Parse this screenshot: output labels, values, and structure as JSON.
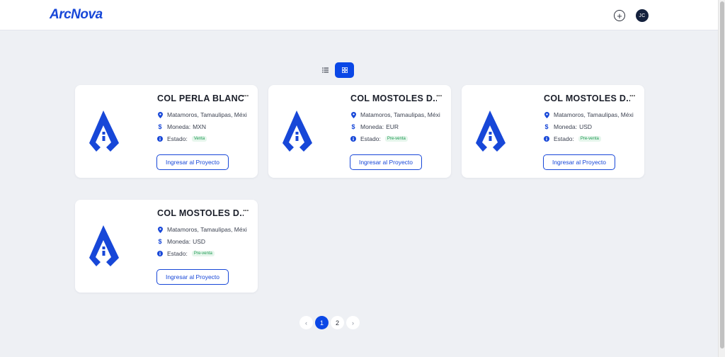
{
  "header": {
    "logo_text": "ArcNova",
    "add_icon": "plus-circle-icon",
    "avatar_initials": "JC"
  },
  "view_toggle": {
    "list_icon": "list-icon",
    "grid_icon": "grid-icon",
    "active": "grid"
  },
  "colors": {
    "brand": "#1747d8",
    "accent": "#0a47e6",
    "badge_text": "#1d9a52",
    "badge_bg": "#e6f6ec"
  },
  "projects": [
    {
      "title": "COL PERLA BLANC...",
      "location": "Matamoros, Tamaulipas, Méxi",
      "currency_label": "Moneda:",
      "currency": "MXN",
      "status_label": "Estado:",
      "status": "Venta",
      "button": "Ingresar al Proyecto"
    },
    {
      "title": "COL MOSTOLES D...",
      "location": "Matamoros, Tamaulipas, Méxi",
      "currency_label": "Moneda:",
      "currency": "EUR",
      "status_label": "Estado:",
      "status": "Pre-venta",
      "button": "Ingresar al Proyecto"
    },
    {
      "title": "COL MOSTOLES D...",
      "location": "Matamoros, Tamaulipas, Méxi",
      "currency_label": "Moneda:",
      "currency": "USD",
      "status_label": "Estado:",
      "status": "Pre-venta",
      "button": "Ingresar al Proyecto"
    },
    {
      "title": "COL MOSTOLES D...",
      "location": "Matamoros, Tamaulipas, Méxi",
      "currency_label": "Moneda:",
      "currency": "USD",
      "status_label": "Estado:",
      "status": "Pre-venta",
      "button": "Ingresar al Proyecto"
    }
  ],
  "pagination": {
    "prev": "‹",
    "pages": [
      "1",
      "2"
    ],
    "current": "1",
    "next": "›"
  }
}
